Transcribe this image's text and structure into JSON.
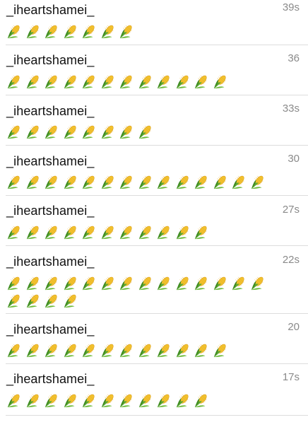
{
  "comments": [
    {
      "username": "_iheartshamei_",
      "timestamp": "39s",
      "corn_count": 7,
      "icon": "corn-icon"
    },
    {
      "username": "_iheartshamei_",
      "timestamp": "36",
      "corn_count": 12,
      "icon": "corn-icon"
    },
    {
      "username": "_iheartshamei_",
      "timestamp": "33s",
      "corn_count": 8,
      "icon": "corn-icon"
    },
    {
      "username": "_iheartshamei_",
      "timestamp": "30",
      "corn_count": 14,
      "icon": "corn-icon"
    },
    {
      "username": "_iheartshamei_",
      "timestamp": "27s",
      "corn_count": 11,
      "icon": "corn-icon"
    },
    {
      "username": "_iheartshamei_",
      "timestamp": "22s",
      "corn_count": 18,
      "icon": "corn-icon"
    },
    {
      "username": "_iheartshamei_",
      "timestamp": "20",
      "corn_count": 12,
      "icon": "corn-icon"
    },
    {
      "username": "_iheartshamei_",
      "timestamp": "17s",
      "corn_count": 11,
      "icon": "corn-icon"
    }
  ],
  "colors": {
    "username": "#111111",
    "timestamp": "#8a8a8a",
    "divider": "#dddddd",
    "corn_kernel": "#f2c12e",
    "corn_husk": "#5aa832"
  }
}
